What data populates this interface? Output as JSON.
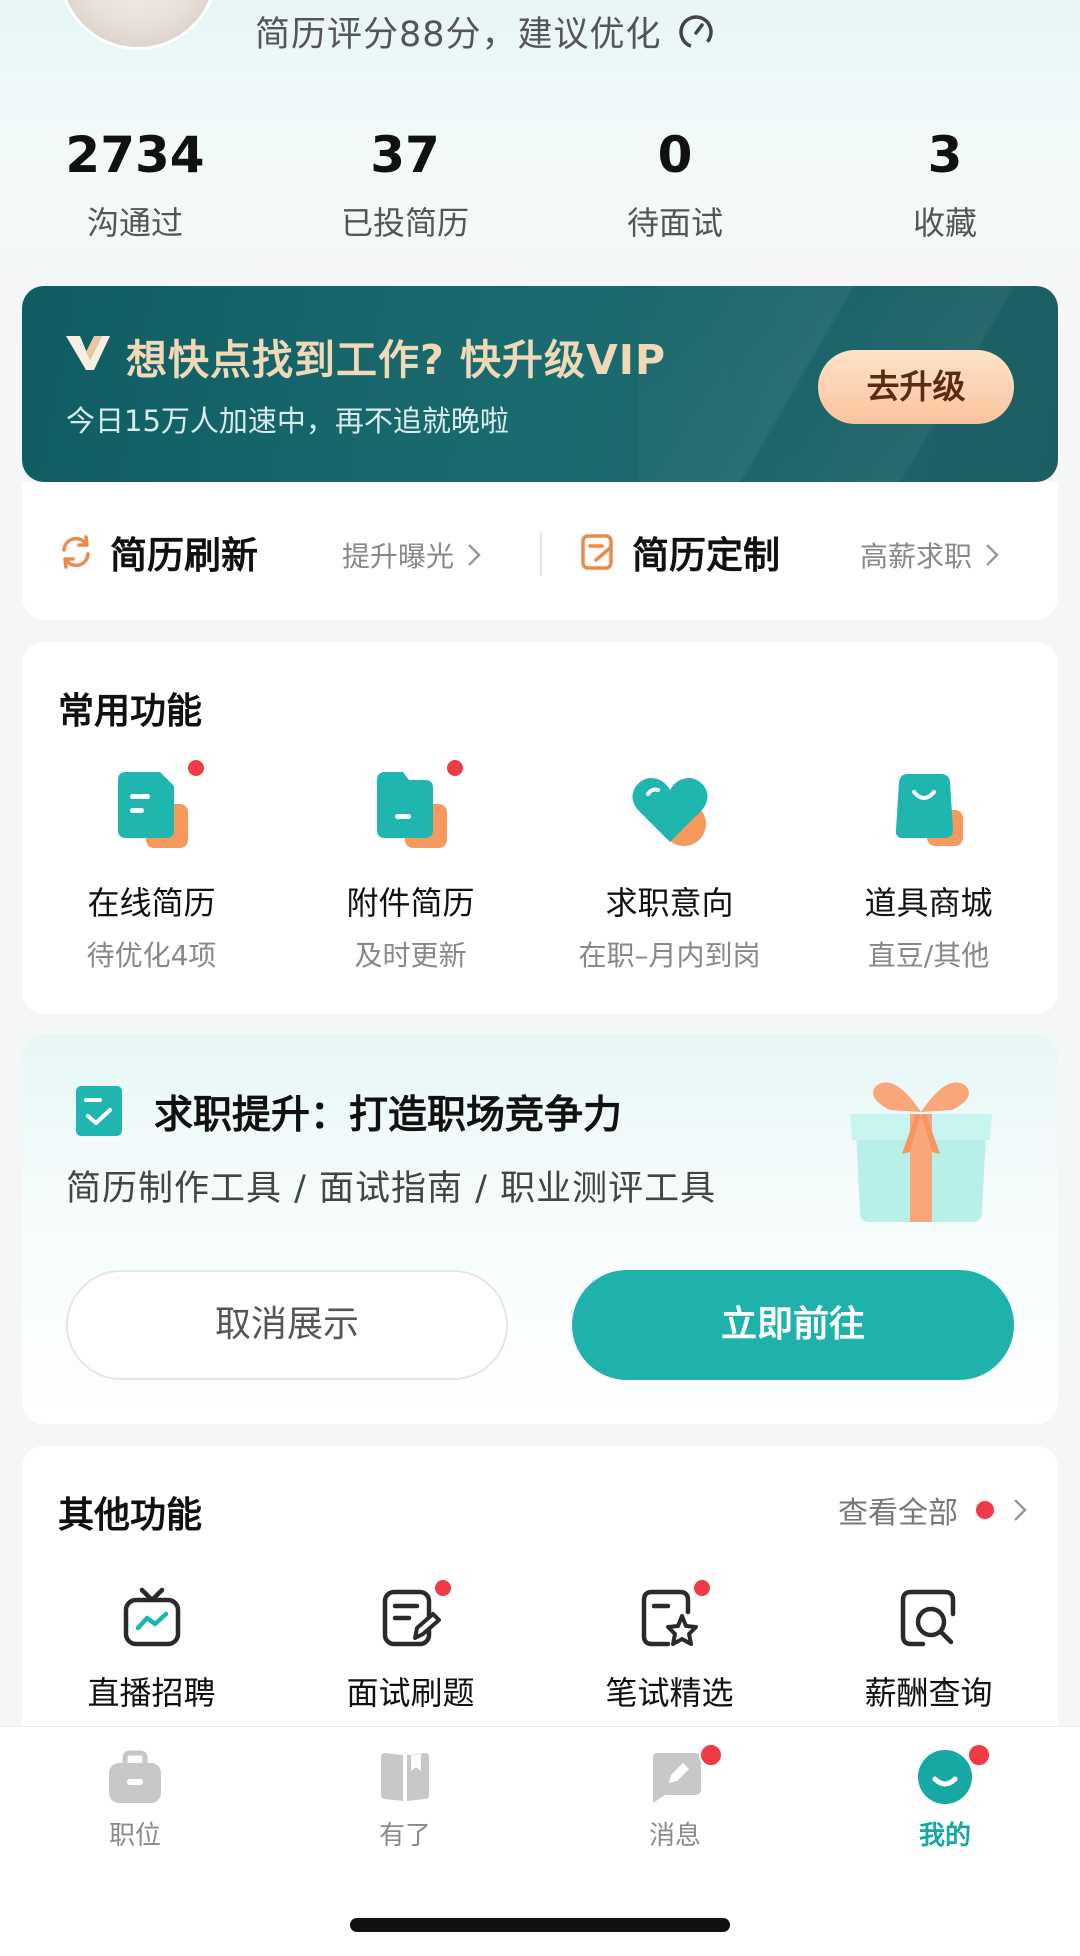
{
  "profile": {
    "score_text": "简历评分88分，建议优化"
  },
  "stats": [
    {
      "value": "2734",
      "label": "沟通过"
    },
    {
      "value": "37",
      "label": "已投简历"
    },
    {
      "value": "0",
      "label": "待面试"
    },
    {
      "value": "3",
      "label": "收藏"
    }
  ],
  "vip_banner": {
    "title": "想快点找到工作? 快升级VIP",
    "subtitle": "今日15万人加速中，再不追就晚啦",
    "button": "去升级"
  },
  "resume_row": {
    "left": {
      "title": "简历刷新",
      "link": "提升曝光"
    },
    "right": {
      "title": "简历定制",
      "link": "高薪求职"
    }
  },
  "common_functions": {
    "title": "常用功能",
    "items": [
      {
        "name": "在线简历",
        "sub": "待优化4项",
        "icon": "online-resume-icon"
      },
      {
        "name": "附件简历",
        "sub": "及时更新",
        "icon": "attachment-resume-icon"
      },
      {
        "name": "求职意向",
        "sub": "在职–月内到岗",
        "icon": "job-intention-icon"
      },
      {
        "name": "道具商城",
        "sub": "直豆/其他",
        "icon": "shop-bag-icon"
      }
    ]
  },
  "promo": {
    "title": "求职提升：打造职场竞争力",
    "subtitle": "简历制作工具 / 面试指南 / 职业测评工具",
    "cancel_button": "取消展示",
    "go_button": "立即前往"
  },
  "other_functions": {
    "title": "其他功能",
    "view_all": "查看全部",
    "items": [
      {
        "name": "直播招聘",
        "icon": "live-tv-icon"
      },
      {
        "name": "面试刷题",
        "icon": "edit-document-icon"
      },
      {
        "name": "笔试精选",
        "icon": "star-document-icon"
      },
      {
        "name": "薪酬查询",
        "icon": "search-document-icon"
      }
    ]
  },
  "tabbar": [
    {
      "label": "职位",
      "icon": "briefcase-icon",
      "active": false
    },
    {
      "label": "有了",
      "icon": "book-icon",
      "active": false
    },
    {
      "label": "消息",
      "icon": "message-icon",
      "active": false
    },
    {
      "label": "我的",
      "icon": "profile-smile-icon",
      "active": true
    }
  ],
  "colors": {
    "accent": "#1fb2ad",
    "vip_bg": "#0f5d63",
    "vip_gold": "#f1d9b8",
    "badge_red": "#f03a47"
  }
}
